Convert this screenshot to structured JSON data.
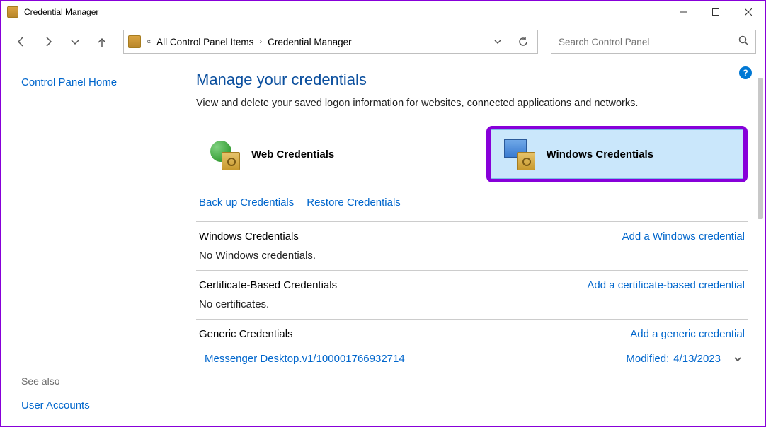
{
  "window": {
    "title": "Credential Manager"
  },
  "breadcrumb": {
    "prefix": "«",
    "items": [
      "All Control Panel Items",
      "Credential Manager"
    ]
  },
  "search": {
    "placeholder": "Search Control Panel"
  },
  "sidebar": {
    "home": "Control Panel Home",
    "see_also_label": "See also",
    "see_also_links": [
      "User Accounts"
    ]
  },
  "main": {
    "heading": "Manage your credentials",
    "description": "View and delete your saved logon information for websites, connected applications and networks.",
    "tiles": {
      "web": "Web Credentials",
      "windows": "Windows Credentials"
    },
    "backup_link": "Back up Credentials",
    "restore_link": "Restore Credentials",
    "sections": [
      {
        "title": "Windows Credentials",
        "action": "Add a Windows credential",
        "empty": "No Windows credentials."
      },
      {
        "title": "Certificate-Based Credentials",
        "action": "Add a certificate-based credential",
        "empty": "No certificates."
      },
      {
        "title": "Generic Credentials",
        "action": "Add a generic credential",
        "entries": [
          {
            "name": "Messenger Desktop.v1/100001766932714",
            "modified_label": "Modified:",
            "modified_date": "4/13/2023"
          }
        ]
      }
    ]
  },
  "help_badge": "?"
}
